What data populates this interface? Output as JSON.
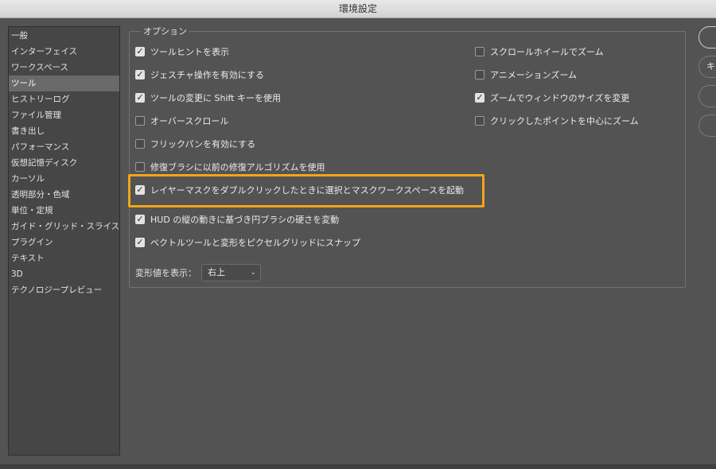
{
  "window": {
    "title": "環境設定"
  },
  "sidebar": {
    "items": [
      {
        "label": "一般"
      },
      {
        "label": "インターフェイス"
      },
      {
        "label": "ワークスペース"
      },
      {
        "label": "ツール",
        "selected": true
      },
      {
        "label": "ヒストリーログ"
      },
      {
        "label": "ファイル管理"
      },
      {
        "label": "書き出し"
      },
      {
        "label": "パフォーマンス"
      },
      {
        "label": "仮想記憶ディスク"
      },
      {
        "label": "カーソル"
      },
      {
        "label": "透明部分・色域"
      },
      {
        "label": "単位・定規"
      },
      {
        "label": "ガイド・グリッド・スライス"
      },
      {
        "label": "プラグイン"
      },
      {
        "label": "テキスト"
      },
      {
        "label": "3D"
      },
      {
        "label": "テクノロジープレビュー"
      }
    ]
  },
  "options": {
    "legend": "オプション",
    "left": [
      {
        "label": "ツールヒントを表示",
        "checked": true
      },
      {
        "label": "ジェスチャ操作を有効にする",
        "checked": true
      },
      {
        "label": "ツールの変更に Shift キーを使用",
        "checked": true
      },
      {
        "label": "オーバースクロール",
        "checked": false
      },
      {
        "label": "フリックパンを有効にする",
        "checked": false
      },
      {
        "label": "修復ブラシに以前の修復アルゴリズムを使用",
        "checked": false
      },
      {
        "label": "レイヤーマスクをダブルクリックしたときに選択とマスクワークスペースを起動",
        "checked": true
      },
      {
        "label": "HUD の縦の動きに基づき円ブラシの硬さを変動",
        "checked": true
      },
      {
        "label": "ベクトルツールと変形をピクセルグリッドにスナップ",
        "checked": true
      }
    ],
    "right": [
      {
        "label": "スクロールホイールでズーム",
        "checked": false
      },
      {
        "label": "アニメーションズーム",
        "checked": false
      },
      {
        "label": "ズームでウィンドウのサイズを変更",
        "checked": true
      },
      {
        "label": "クリックしたポイントを中心にズーム",
        "checked": false
      }
    ],
    "transform_label": "変形値を表示：",
    "transform_value": "右上"
  },
  "buttons": {
    "b1": "",
    "b2": "キ",
    "b3": "",
    "b4": ""
  },
  "colors": {
    "highlight": "#f0a51a",
    "panel": "#535353"
  }
}
